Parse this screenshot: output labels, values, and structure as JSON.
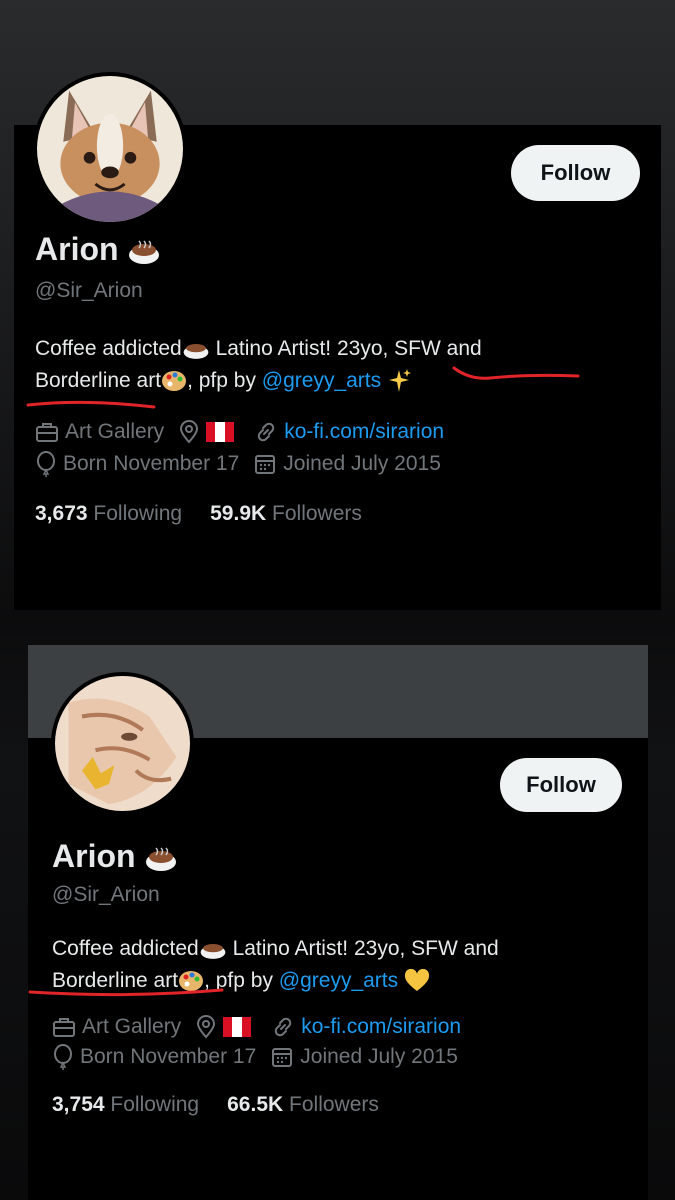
{
  "profiles": [
    {
      "name": "Arion",
      "handle": "@Sir_Arion",
      "bio_line1": "Coffee addicted",
      "bio_line1b": " Latino Artist! 23yo, SFW and",
      "bio_line2a": "Borderline art",
      "bio_line2b": ", pfp by ",
      "bio_mention": "@greyy_arts",
      "bio_end_emoji": "sparkles-emoji",
      "follow_label": "Follow",
      "category": "Art Gallery",
      "website": "ko-fi.com/sirarion",
      "born": "Born November 17",
      "joined": "Joined July 2015",
      "following_count": "3,673",
      "following_label": "Following",
      "followers_count": "59.9K",
      "followers_label": "Followers"
    },
    {
      "name": "Arion",
      "handle": "@Sir_Arion",
      "bio_line1": "Coffee addicted",
      "bio_line1b": " Latino Artist! 23yo, SFW and",
      "bio_line2a": "Borderline art",
      "bio_line2b": ", pfp by ",
      "bio_mention": "@greyy_arts",
      "bio_end_emoji": "yellow-heart-emoji",
      "follow_label": "Follow",
      "category": "Art Gallery",
      "website": "ko-fi.com/sirarion",
      "born": "Born November 17",
      "joined": "Joined July 2015",
      "following_count": "3,754",
      "following_label": "Following",
      "followers_count": "66.5K",
      "followers_label": "Followers"
    }
  ],
  "colors": {
    "background": "#000000",
    "text": "#e7e9ea",
    "muted": "#71767b",
    "link": "#1d9bf0",
    "annotation": "#e0242a",
    "flag_red": "#d91023"
  }
}
